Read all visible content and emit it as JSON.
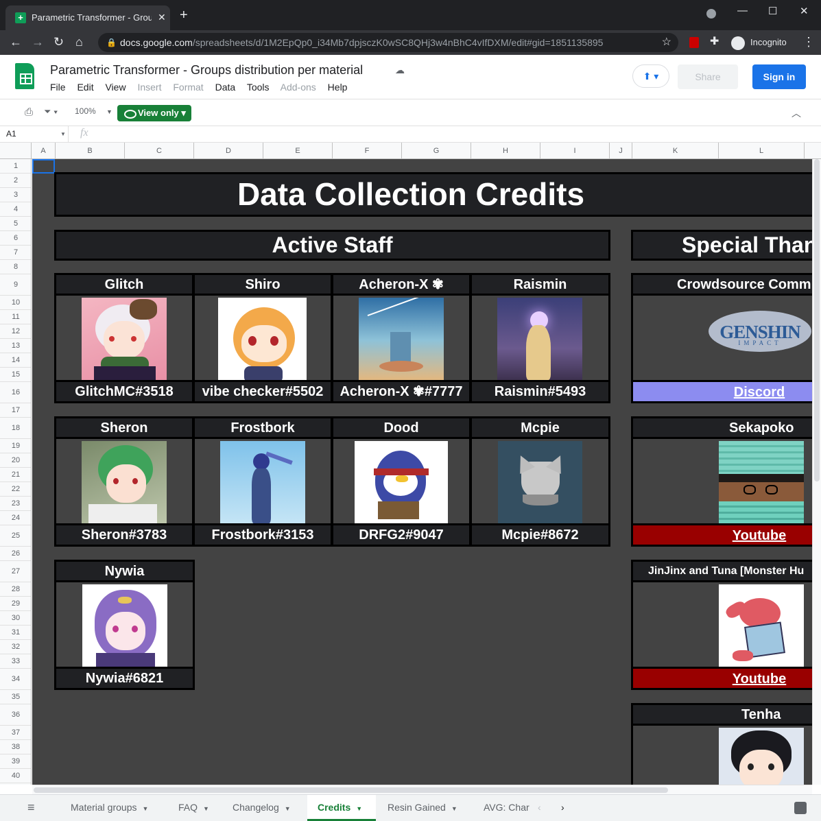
{
  "browser": {
    "tab_title": "Parametric Transformer - Groups",
    "url_domain": "docs.google.com",
    "url_path": "/spreadsheets/d/1M2EpQp0_i34Mb7dpjsczK0wSC8QHj3w4nBhC4vIfDXM/edit#gid=1851135895",
    "profile": "Incognito"
  },
  "doc": {
    "title": "Parametric Transformer - Groups distribution per material",
    "menus": [
      "File",
      "Edit",
      "View",
      "Insert",
      "Format",
      "Data",
      "Tools",
      "Add-ons",
      "Help"
    ],
    "share": "Share",
    "signin": "Sign in"
  },
  "toolbar": {
    "zoom": "100%",
    "view_only": "View only"
  },
  "formula": {
    "cell": "A1",
    "fx": "fx"
  },
  "columns": [
    "A",
    "B",
    "C",
    "D",
    "E",
    "F",
    "G",
    "H",
    "I",
    "J",
    "K",
    "L"
  ],
  "rows": [
    "1",
    "2",
    "3",
    "4",
    "5",
    "6",
    "7",
    "8",
    "9",
    "10",
    "11",
    "12",
    "13",
    "14",
    "15",
    "16",
    "17",
    "18",
    "19",
    "20",
    "21",
    "22",
    "23",
    "24",
    "25",
    "26",
    "27",
    "28",
    "29",
    "30",
    "31",
    "32",
    "33",
    "34",
    "35",
    "36",
    "37",
    "38",
    "39",
    "40"
  ],
  "credits": {
    "title": "Data Collection Credits",
    "active_staff": "Active Staff",
    "special_thanks": "Special Than",
    "staff": [
      {
        "name": "Glitch",
        "tag": "GlitchMC#3518"
      },
      {
        "name": "Shiro",
        "tag": "vibe checker#5502"
      },
      {
        "name": "Acheron-X ✾",
        "tag": "Acheron-X ✾#7777"
      },
      {
        "name": "Raismin",
        "tag": "Raismin#5493"
      },
      {
        "name": "Sheron",
        "tag": "Sheron#3783"
      },
      {
        "name": "Frostbork",
        "tag": "Frostbork#3153"
      },
      {
        "name": "Dood",
        "tag": "DRFG2#9047"
      },
      {
        "name": "Mcpie",
        "tag": "Mcpie#8672"
      },
      {
        "name": "Nywia",
        "tag": "Nywia#6821"
      }
    ],
    "thanks": [
      {
        "name": "Crowdsource Comm",
        "link": "Discord",
        "logo": "GENSHIN",
        "logo_sub": "IMPACT"
      },
      {
        "name": "Sekapoko",
        "link": "Youtube"
      },
      {
        "name": "JinJinx and Tuna [Monster Hu",
        "link": "Youtube"
      },
      {
        "name": "Tenha"
      }
    ]
  },
  "sheet_tabs": [
    "Material groups",
    "FAQ",
    "Changelog",
    "Credits",
    "Resin Gained",
    "AVG: Char"
  ],
  "colors": {
    "grid_bg": "#434343",
    "header_bg": "#202124",
    "discord": "#8c8cf0",
    "youtube": "#990000",
    "sheets_green": "#0f9d58",
    "primary_blue": "#1a73e8"
  }
}
